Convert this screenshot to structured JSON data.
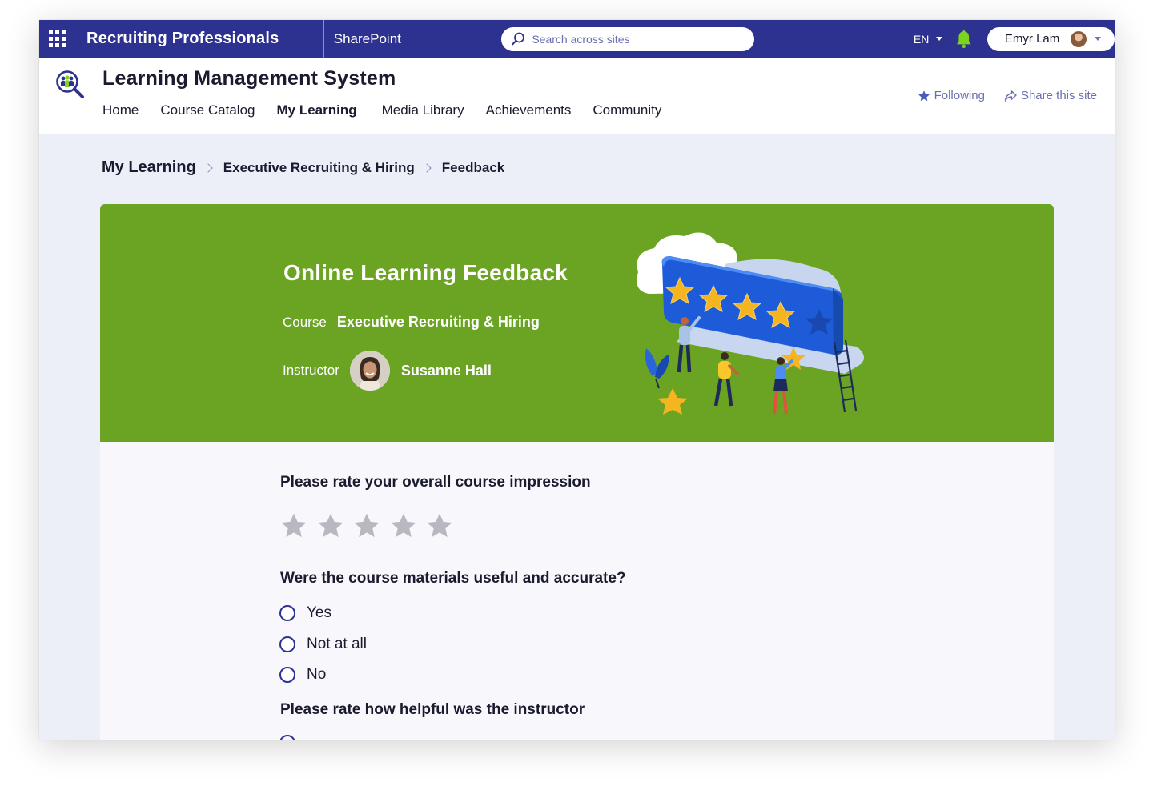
{
  "suite": {
    "site_name": "Recruiting Professionals",
    "app_name": "SharePoint",
    "search_placeholder": "Search across sites",
    "language": "EN",
    "user_name": "Emyr Lam"
  },
  "site": {
    "title": "Learning Management System",
    "nav": [
      "Home",
      "Course Catalog",
      "My Learning",
      "Media Library",
      "Achievements",
      "Community"
    ],
    "active_nav": "My Learning",
    "following_label": "Following",
    "share_label": "Share this site"
  },
  "breadcrumb": {
    "root": "My Learning",
    "course": "Executive Recruiting & Hiring",
    "current": "Feedback"
  },
  "hero": {
    "title": "Online Learning Feedback",
    "course_label": "Course",
    "course_value": "Executive Recruiting & Hiring",
    "instructor_label": "Instructor",
    "instructor_name": "Susanne Hall",
    "background_color": "#6ba323"
  },
  "form": {
    "q1": "Please rate your overall course impression",
    "rating_max": 5,
    "rating_value": 0,
    "q2": "Were the course materials useful and accurate?",
    "q2_options": [
      "Yes",
      "Not at all",
      "No"
    ],
    "q3": "Please rate how helpful was the instructor"
  },
  "colors": {
    "suite_bar": "#2d3291",
    "accent": "#2d3291",
    "notification": "#7ed321",
    "star_empty": "#b8b8c0"
  }
}
